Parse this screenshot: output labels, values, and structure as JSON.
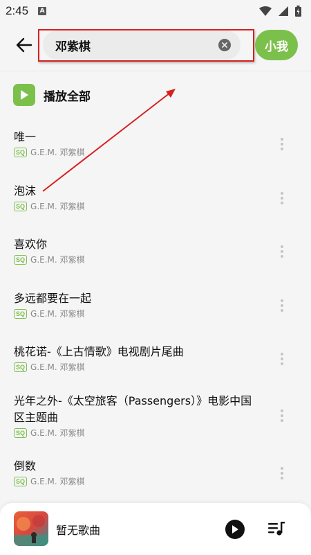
{
  "status_bar": {
    "time": "2:45",
    "a_badge": "A"
  },
  "search": {
    "query": "邓紫棋",
    "button_label": "小我"
  },
  "play_all": {
    "label": "播放全部"
  },
  "songs": [
    {
      "title": "唯一",
      "badge": "SQ",
      "artist": "G.E.M. 邓紫棋"
    },
    {
      "title": "泡沫",
      "badge": "SQ",
      "artist": "G.E.M. 邓紫棋"
    },
    {
      "title": "喜欢你",
      "badge": "SQ",
      "artist": "G.E.M. 邓紫棋"
    },
    {
      "title": "多远都要在一起",
      "badge": "SQ",
      "artist": "G.E.M. 邓紫棋"
    },
    {
      "title": "桃花诺-《上古情歌》电视剧片尾曲",
      "badge": "SQ",
      "artist": "G.E.M. 邓紫棋"
    },
    {
      "title": "光年之外-《太空旅客（Passengers）》电影中国区主题曲",
      "badge": "SQ",
      "artist": "G.E.M. 邓紫棋"
    },
    {
      "title": "倒数",
      "badge": "SQ",
      "artist": "G.E.M. 邓紫棋"
    }
  ],
  "player": {
    "title": "暂无歌曲"
  },
  "colors": {
    "accent": "#7cc04c",
    "annotation": "#d62020"
  },
  "icons": [
    "back-arrow-icon",
    "clear-icon",
    "play-icon",
    "more-vertical-icon",
    "queue-music-icon",
    "wifi-icon",
    "signal-icon",
    "battery-icon"
  ]
}
